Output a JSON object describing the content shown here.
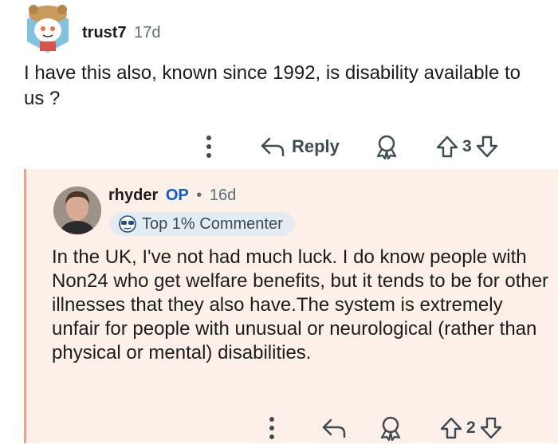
{
  "top_comment": {
    "author": "trust7",
    "time": "17d",
    "text": "I have this also, known since 1992, is disability available to us ?",
    "actions": {
      "more_icon": "more-vertical-icon",
      "reply_label": "Reply",
      "award_icon": "award-icon",
      "score": "3"
    }
  },
  "reply_comment": {
    "author": "rhyder",
    "op_badge": "OP",
    "separator": "•",
    "time": "16d",
    "flair": "Top 1% Commenter",
    "text": "In the UK, I've not had much luck. I do know people with Non24 who get welfare benefits, but it tends to be for other illnesses that they also have.The system is extremely unfair for people with unusual or neurological (rather than physical or mental) disabilities.",
    "actions": {
      "score": "2"
    }
  },
  "colors": {
    "reply_background": "#fcf0e9",
    "thread_line": "#f2a28a",
    "op_blue": "#0a5ccf",
    "icon_gray": "#3e4c50"
  }
}
